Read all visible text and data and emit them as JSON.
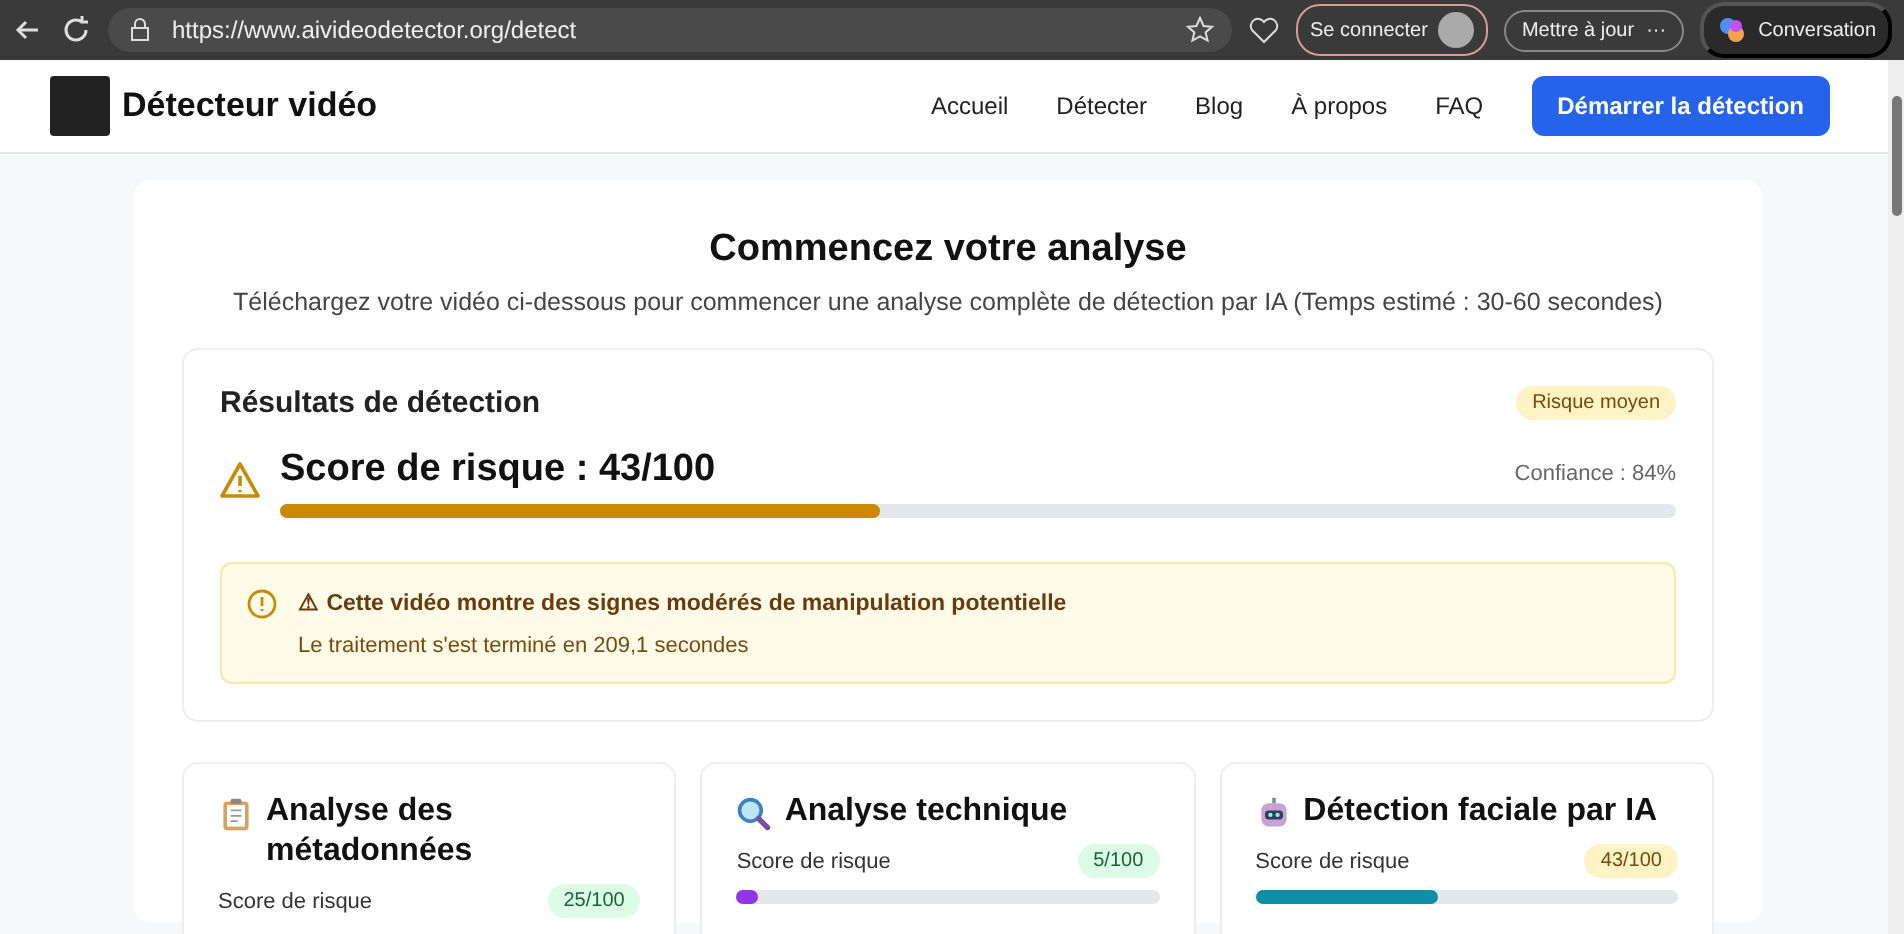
{
  "browser": {
    "url": "https://www.aivideodetector.org/detect",
    "sign_in": "Se connecter",
    "update": "Mettre à jour",
    "update_more": "···",
    "copilot": "Conversation"
  },
  "header": {
    "brand": "Détecteur vidéo",
    "nav": [
      {
        "label": "Accueil"
      },
      {
        "label": "Détecter"
      },
      {
        "label": "Blog"
      },
      {
        "label": "À propos"
      },
      {
        "label": "FAQ"
      }
    ],
    "cta": "Démarrer la détection"
  },
  "intro": {
    "title": "Commencez votre analyse",
    "subtitle": "Téléchargez votre vidéo ci-dessous pour commencer une analyse complète de détection par IA (Temps estimé : 30-60 secondes)"
  },
  "results": {
    "title": "Résultats de détection",
    "badge": "Risque moyen",
    "score": "Score de risque : 43/100",
    "confidence": "Confiance : 84%",
    "level": 0.43,
    "alert": "⚠ Cette vidéo montre des signes modérés de manipulation potentielle",
    "time": "Le traitement s'est terminé en 209,1 secondes"
  },
  "cards": [
    {
      "kind": "clipboard",
      "title": "Analyse des métadonnées",
      "label": "Score de risque",
      "score": "25/100"
    },
    {
      "kind": "magnifier",
      "title": "Analyse technique",
      "label": "Score de risque",
      "score": "5/100",
      "level": 0.05,
      "color": "#9333ea"
    },
    {
      "kind": "robot",
      "title": "Détection faciale par IA",
      "label": "Score de risque",
      "score": "43/100",
      "level": 0.43,
      "color": "#0e8fa8"
    }
  ]
}
